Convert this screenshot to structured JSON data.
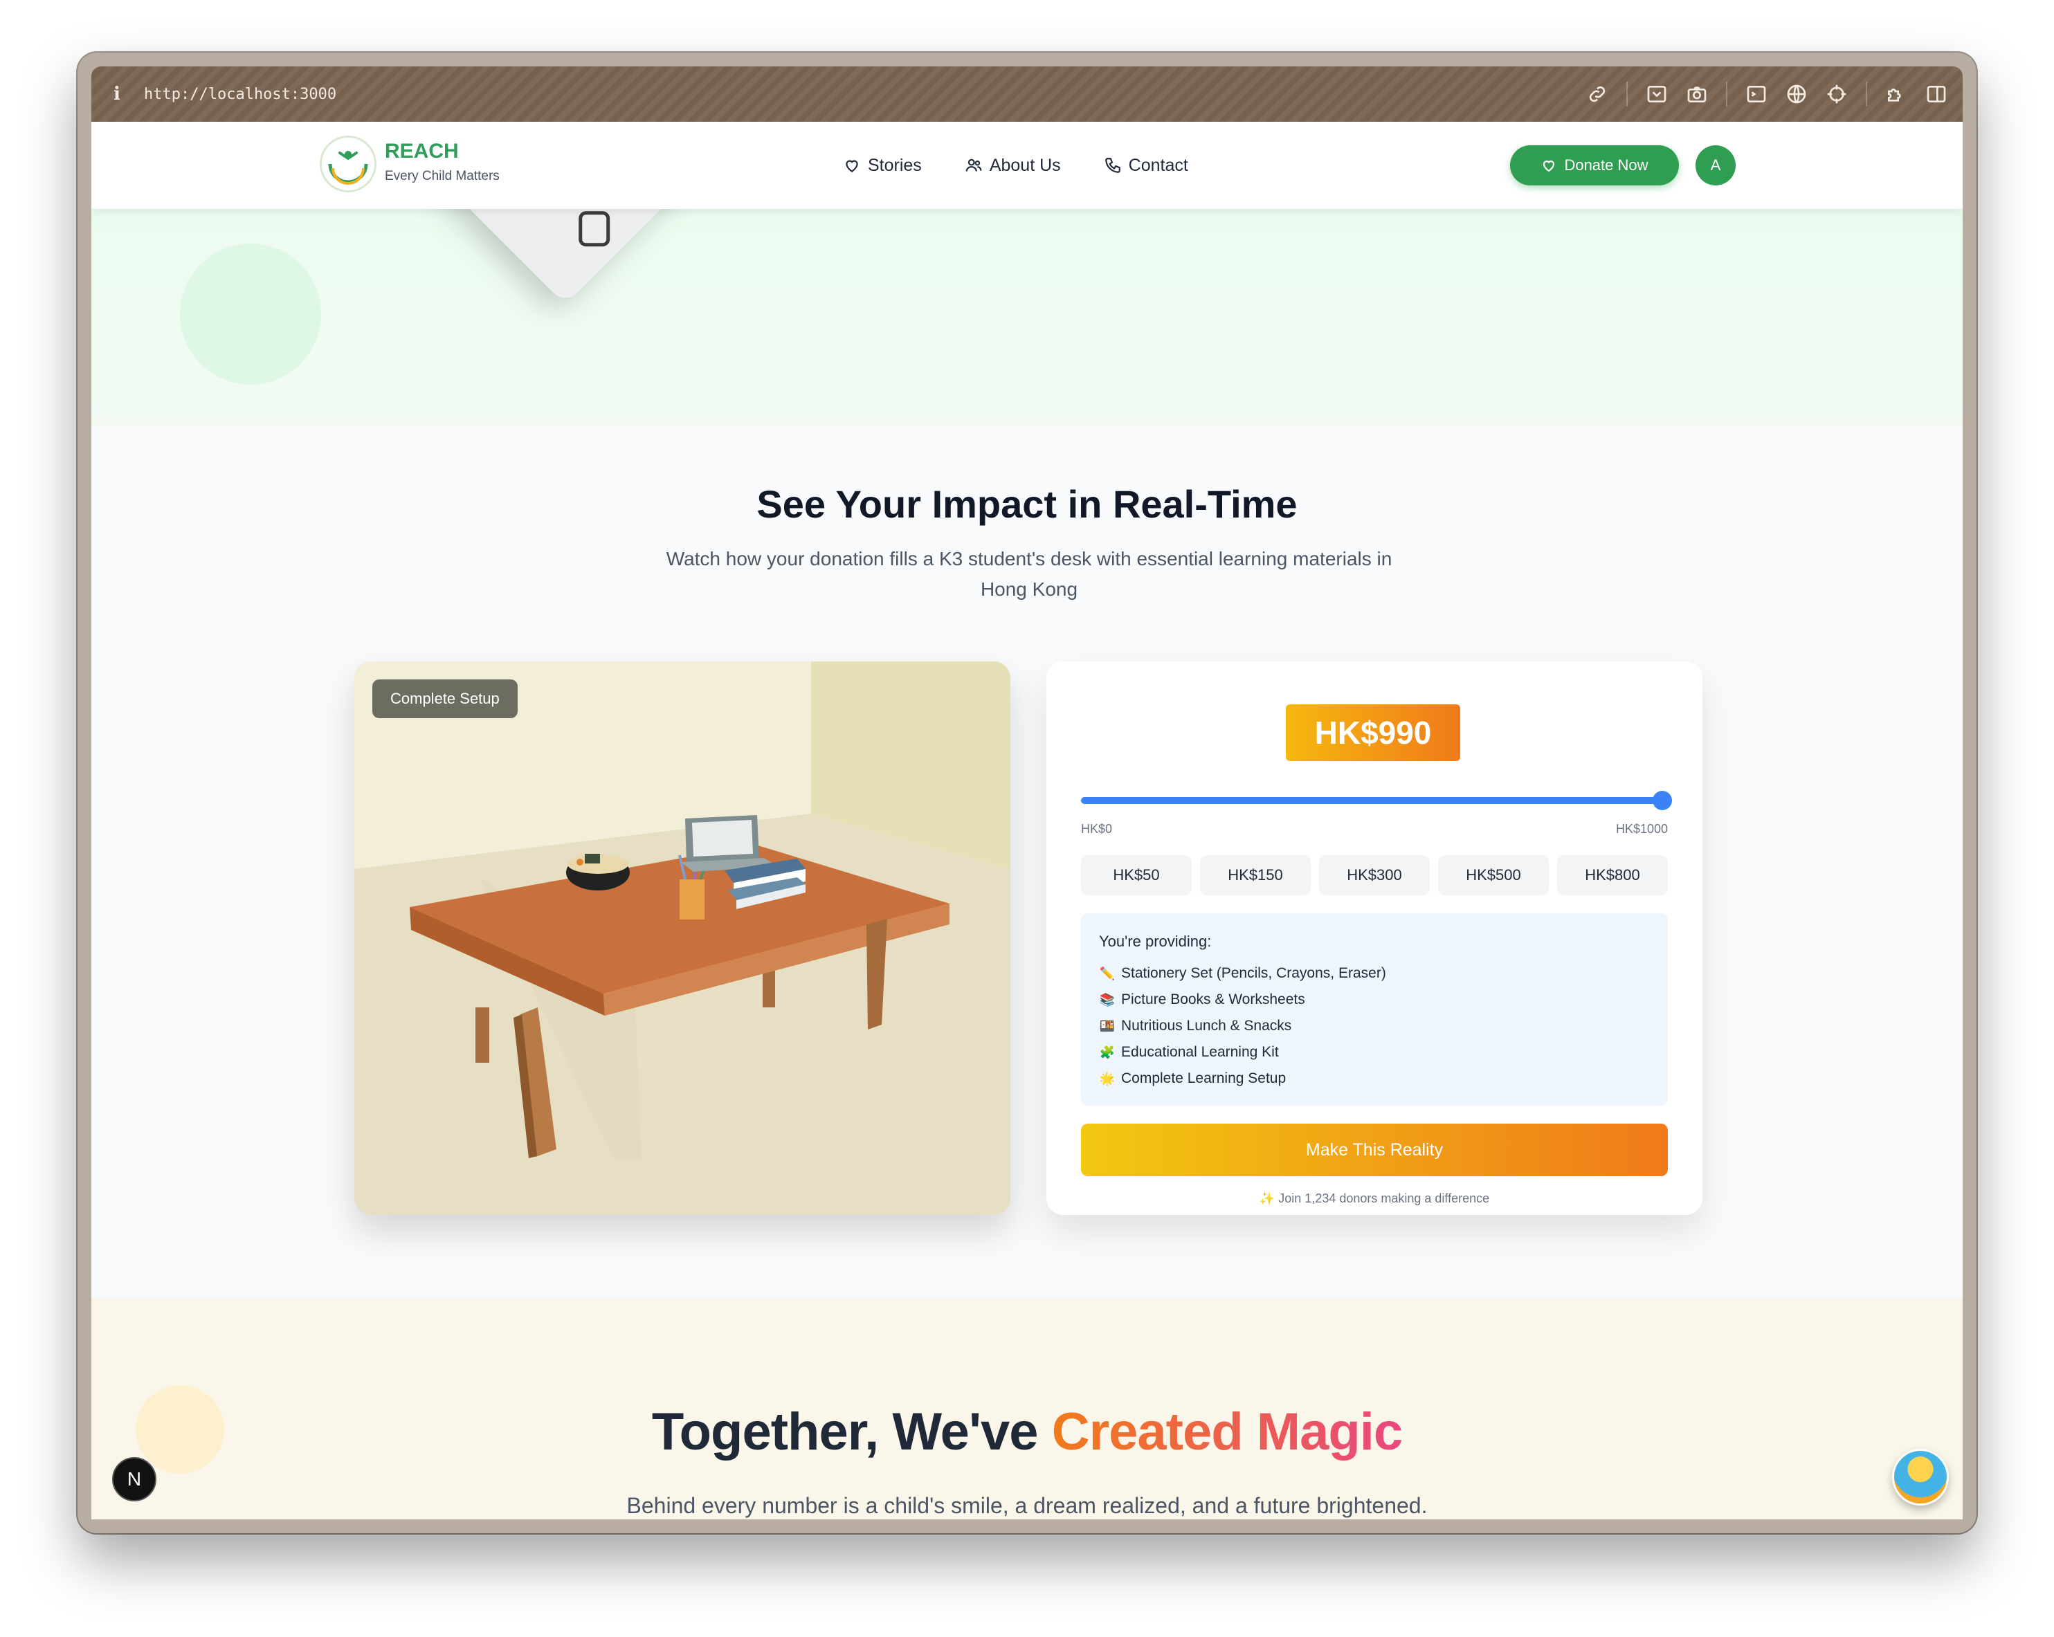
{
  "browser": {
    "url": "http://localhost:3000"
  },
  "nav": {
    "brand": "REACH",
    "tagline": "Every Child Matters",
    "links": [
      {
        "label": "Stories",
        "icon": "heart-icon"
      },
      {
        "label": "About Us",
        "icon": "users-icon"
      },
      {
        "label": "Contact",
        "icon": "phone-icon"
      }
    ],
    "donate_label": "Donate Now",
    "avatar_initial": "A"
  },
  "impact": {
    "title": "See Your Impact in Real-Time",
    "subtitle": "Watch how your donation fills a K3 student's desk with essential learning materials in Hong Kong",
    "scene_badge": "Complete Setup",
    "amount": "HK$990",
    "slider": {
      "value": 990,
      "min": 0,
      "max": 1000,
      "min_label": "HK$0",
      "max_label": "HK$1000"
    },
    "presets": [
      "HK$50",
      "HK$150",
      "HK$300",
      "HK$500",
      "HK$800"
    ],
    "providing_title": "You're providing:",
    "providing_items": [
      {
        "icon": "✏️",
        "text": "Stationery Set (Pencils, Crayons, Eraser)"
      },
      {
        "icon": "📚",
        "text": "Picture Books & Worksheets"
      },
      {
        "icon": "🍱",
        "text": "Nutritious Lunch & Snacks"
      },
      {
        "icon": "🧩",
        "text": "Educational Learning Kit"
      },
      {
        "icon": "🌟",
        "text": "Complete Learning Setup"
      }
    ],
    "cta_label": "Make This Reality",
    "joiners_icon": "✨",
    "joiners_text": "Join 1,234 donors making a difference"
  },
  "stats": {
    "title_plain": "Together, We've ",
    "title_accent": "Created Magic",
    "subtitle": "Behind every number is a child's smile, a dream realized, and a future brightened."
  },
  "floating": {
    "next_badge": "N"
  },
  "colors": {
    "brand_green": "#2f9e50",
    "slider_blue": "#3b82f6",
    "gradient_start": "#f2c811",
    "gradient_end": "#f07a1a",
    "accent_pink": "#e8487e"
  }
}
